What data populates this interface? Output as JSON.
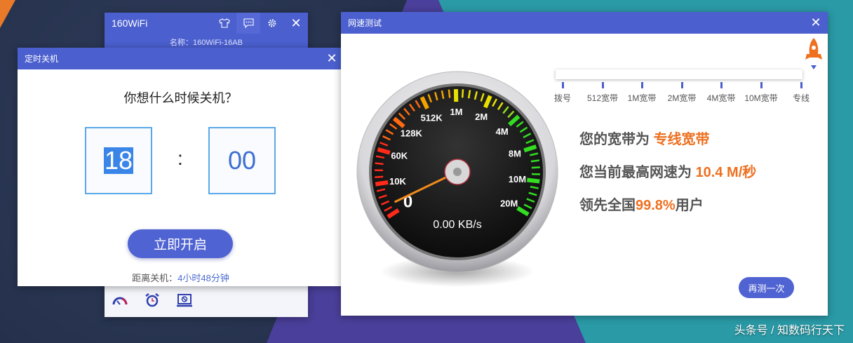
{
  "wifi_window": {
    "title": "160WiFi",
    "subtitle": "名称：160WiFi-16AB",
    "icons": [
      "shirt-icon",
      "chat-icon",
      "gear-icon",
      "close-icon"
    ],
    "tools": [
      "speedometer-icon",
      "alarm-clock-icon",
      "laptop-block-icon"
    ]
  },
  "timer_dialog": {
    "title": "定时关机",
    "question": "你想什么时候关机？",
    "hour": "18",
    "separator": ":",
    "minute": "00",
    "start_label": "立即开启",
    "remaining_label": "距离关机：",
    "remaining_value": "4小时48分钟"
  },
  "speed_window": {
    "title": "网速测试",
    "scale": [
      "拨号",
      "512宽带",
      "1M宽带",
      "2M宽带",
      "4M宽带",
      "10M宽带",
      "专线"
    ],
    "gauge": {
      "labels": [
        "0",
        "10K",
        "60K",
        "128K",
        "512K",
        "1M",
        "2M",
        "4M",
        "8M",
        "10M",
        "20M"
      ],
      "readout": "0.00 KB/s",
      "needle_value": 0.3
    },
    "result1_prefix": "您的宽带为 ",
    "result1_value": "专线宽带",
    "result2_prefix": "您当前最高网速为 ",
    "result2_value": "10.4 M/秒",
    "result3_prefix": "领先全国",
    "result3_value": "99.8%",
    "result3_suffix": "用户",
    "retest_label": "再测一次"
  },
  "watermark": "头条号 / 知数码行天下",
  "colors": {
    "primary": "#4b5fce",
    "accent": "#ee7020"
  }
}
